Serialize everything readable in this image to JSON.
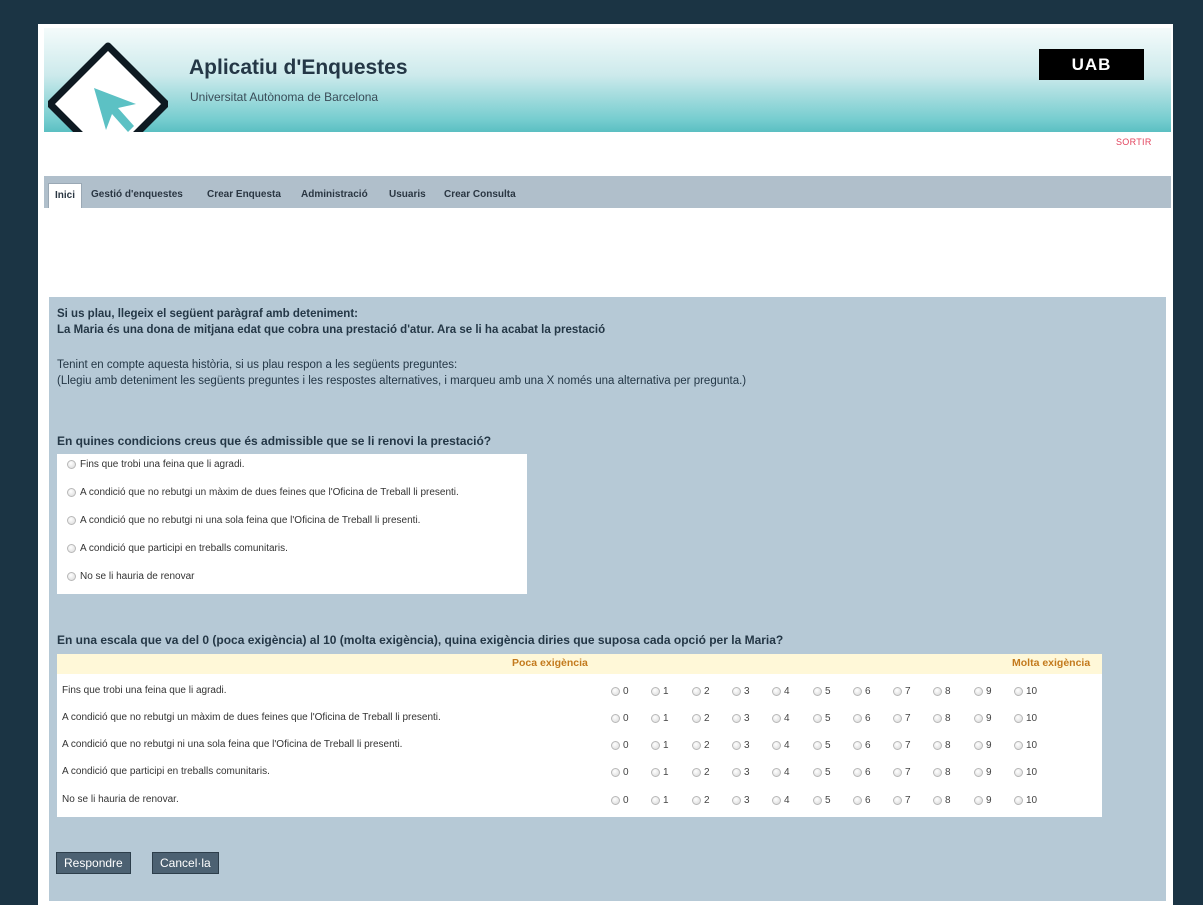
{
  "header": {
    "app_title": "Aplicatiu d'Enquestes",
    "app_subtitle": "Universitat Autònoma de Barcelona",
    "brand_logo_text": "UAB",
    "logout_label": "SORTIR"
  },
  "nav": {
    "tabs": [
      {
        "label": "Inici",
        "active": true
      },
      {
        "label": "Gestió d'enquestes"
      },
      {
        "label": "Crear Enquesta"
      },
      {
        "label": "Administració"
      },
      {
        "label": "Usuaris"
      },
      {
        "label": "Crear Consulta"
      }
    ]
  },
  "intro": {
    "line1": "Si us plau, llegeix el següent paràgraf amb deteniment:",
    "line2": "La Maria és una dona de mitjana edat que cobra una prestació d'atur. Ara se li ha acabat la prestació",
    "line3": "Tenint en compte aquesta història, si us plau respon a les següents preguntes:",
    "line4": "(Llegiu amb deteniment les següents preguntes i les respostes alternatives, i marqueu amb una X només una alternativa per pregunta.)"
  },
  "question1": {
    "title": "En quines condicions creus que és admissible que se li renovi la prestació?",
    "options": [
      "Fins que trobi una feina que li agradi.",
      "A condició que no rebutgi un màxim de dues feines que l'Oficina de Treball li presenti.",
      "A condició que no rebutgi ni una sola feina que l'Oficina de Treball li presenti.",
      "A condició que participi en treballs comunitaris.",
      "No se li hauria de renovar"
    ]
  },
  "question2": {
    "title": "En una escala que va del 0 (poca exigència) al 10 (molta exigència), quina exigència diries que suposa cada opció per la Maria?",
    "low_label": "Poca exigència",
    "high_label": "Molta exigència",
    "scale": [
      "0",
      "1",
      "2",
      "3",
      "4",
      "5",
      "6",
      "7",
      "8",
      "9",
      "10"
    ],
    "rows": [
      "Fins que trobi una feina que li agradi.",
      "A condició que no rebutgi un màxim de dues feines que l'Oficina de Treball li presenti.",
      "A condició que no rebutgi ni una sola feina que l'Oficina de Treball li presenti.",
      "A condició que participi en treballs comunitaris.",
      "No se li hauria de renovar."
    ]
  },
  "buttons": {
    "submit_label": "Respondre",
    "cancel_label": "Cancel·la"
  },
  "colors": {
    "page_background": "#1b3444",
    "nav_background": "#b0bfcb",
    "content_background": "#b6c9d6",
    "button_background": "#4c6172",
    "scale_label": "#c37a1d",
    "logout": "#e2435d"
  }
}
